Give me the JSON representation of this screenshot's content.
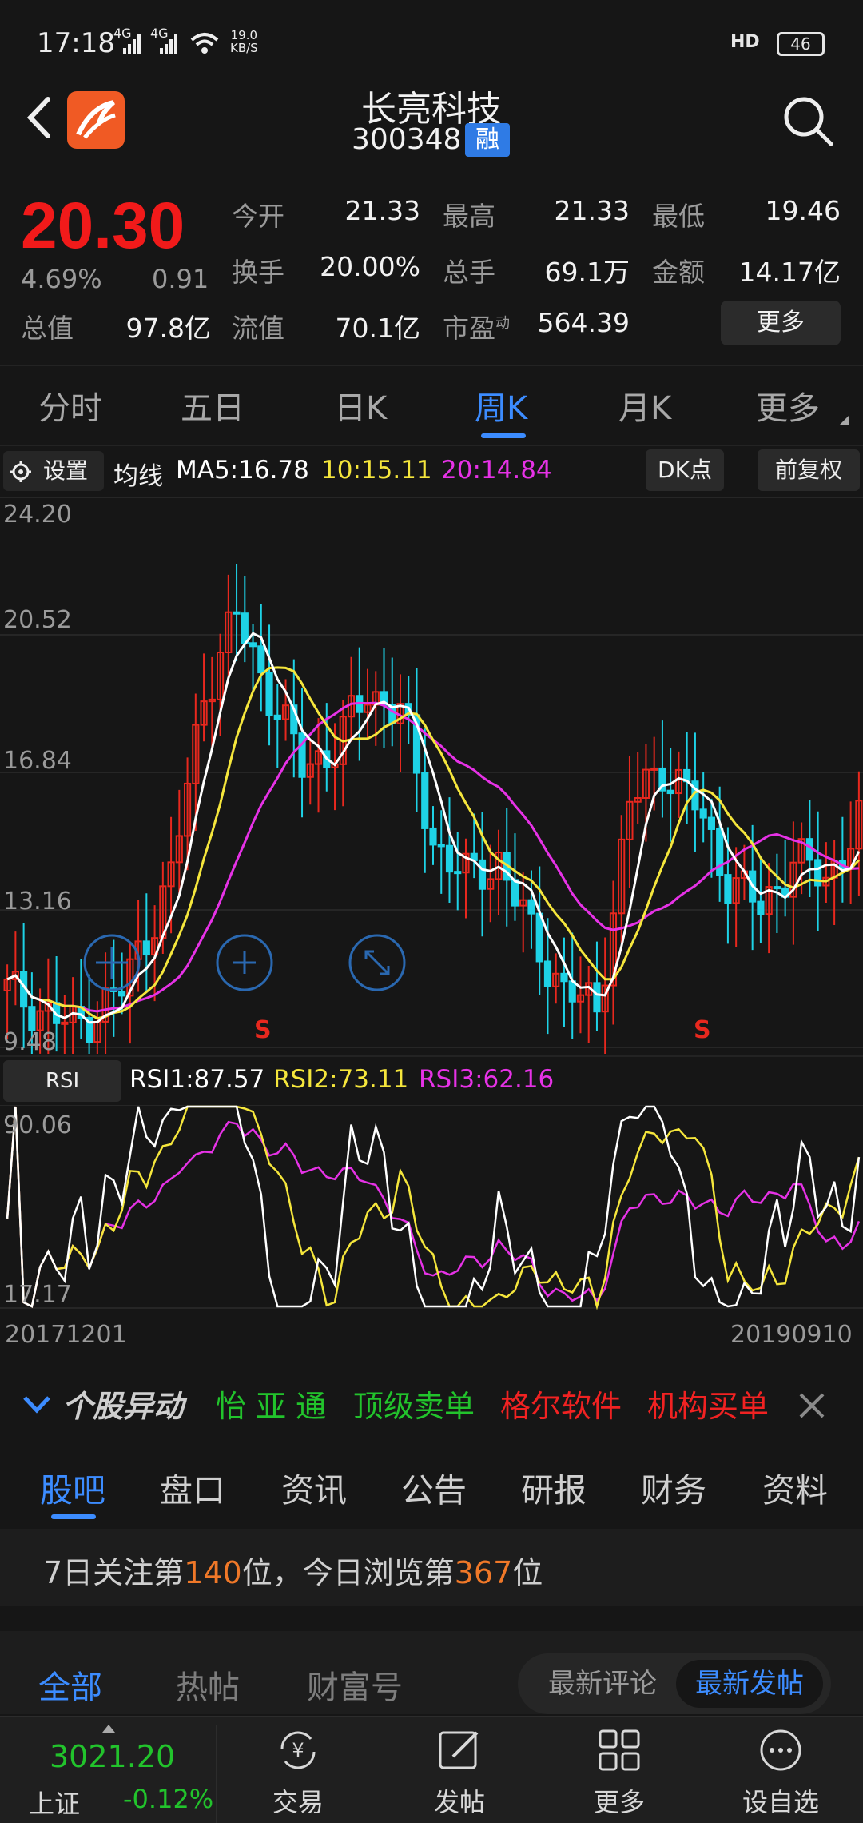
{
  "status": {
    "time": "17:18",
    "net1": "4G",
    "net2": "4G",
    "speed_value": "19.0",
    "speed_unit": "KB/S",
    "hd": "HD",
    "battery": "46"
  },
  "header": {
    "title": "长亮科技",
    "code": "300348",
    "badge": "融"
  },
  "quote": {
    "price": "20.30",
    "change_pct": "4.69%",
    "change_amt": "0.91",
    "open_label": "今开",
    "open": "21.33",
    "high_label": "最高",
    "high": "21.33",
    "low_label": "最低",
    "low": "19.46",
    "turnover_label": "换手",
    "turnover": "20.00%",
    "volume_label": "总手",
    "volume": "69.1万",
    "amount_label": "金额",
    "amount": "14.17亿",
    "mcap_label": "总值",
    "mcap": "97.8亿",
    "float_label": "流值",
    "float": "70.1亿",
    "pe_label": "市盈",
    "pe_sup": "动",
    "pe": "564.39",
    "more": "更多"
  },
  "period_tabs": [
    "分时",
    "五日",
    "日K",
    "周K",
    "月K",
    "更多"
  ],
  "ma_bar": {
    "settings": "设置",
    "ma_label": "均线",
    "ma5": "MA5:16.78",
    "ma10": "10:15.11",
    "ma20": "20:14.84",
    "dk": "DK点",
    "adjust": "前复权"
  },
  "chart_data": {
    "type": "candlestick",
    "y_ticks": [
      "24.20",
      "20.52",
      "16.84",
      "13.16",
      "9.48"
    ],
    "ylim": [
      9.48,
      24.2
    ],
    "signals": [
      "S",
      "S"
    ],
    "rsi": {
      "button": "RSI",
      "rsi1": "RSI1:87.57",
      "rsi2": "RSI2:73.11",
      "rsi3": "RSI3:62.16",
      "y_ticks": [
        "90.06",
        "17.17"
      ]
    },
    "date_start": "20171201",
    "date_end": "20190910",
    "colors": {
      "up": "#e8281e",
      "down": "#1ed2e6",
      "ma5": "#ffffff",
      "ma10": "#f5e63c",
      "ma20": "#e632e6"
    }
  },
  "ticker": {
    "title": "个股异动",
    "items": [
      "怡 亚 通",
      "顶级卖单",
      "格尔软件",
      "机构买单"
    ]
  },
  "section_tabs": [
    "股吧",
    "盘口",
    "资讯",
    "公告",
    "研报",
    "财务",
    "资料"
  ],
  "rank": {
    "p1": "7日关注第",
    "n1": "140",
    "p2": "位，今日浏览第",
    "n2": "367",
    "p3": "位"
  },
  "feed": {
    "tabs": [
      "全部",
      "热帖",
      "财富号"
    ],
    "sort": [
      "最新评论",
      "最新发帖"
    ]
  },
  "bottom_nav": {
    "index_value": "3021.20",
    "index_name": "上证",
    "index_change": "-0.12%",
    "items": [
      "交易",
      "发帖",
      "更多",
      "设自选"
    ]
  }
}
